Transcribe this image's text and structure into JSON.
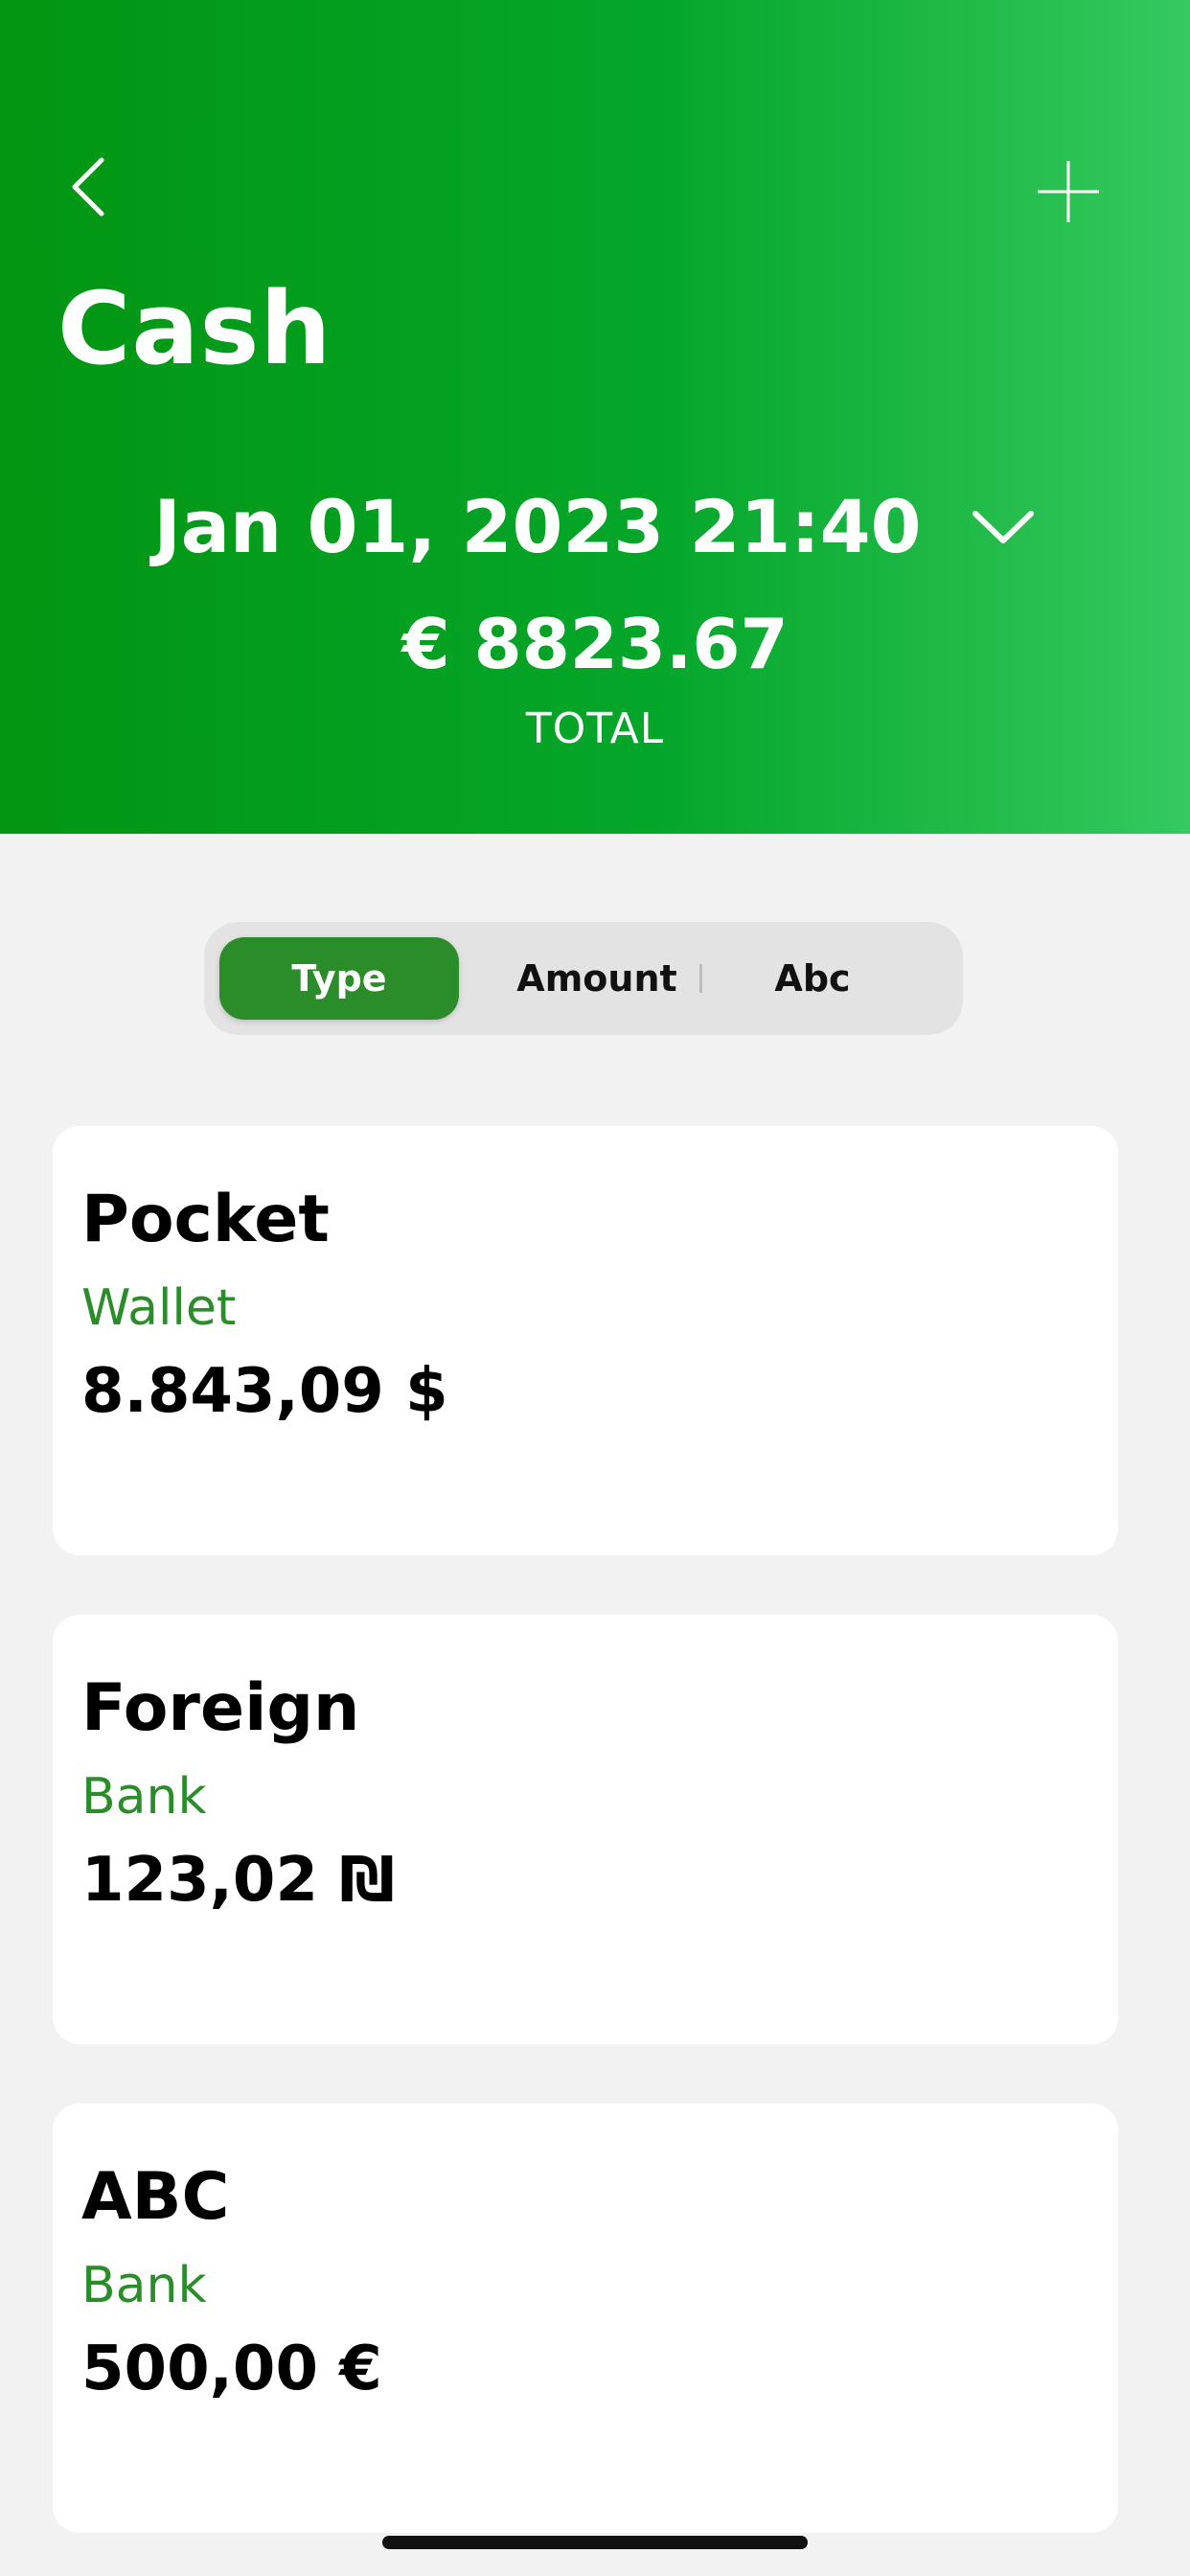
{
  "header": {
    "title": "Cash",
    "date": "Jan 01, 2023 21:40",
    "total_amount": "€ 8823.67",
    "total_label": "TOTAL",
    "colors": {
      "gradient_start": "#029512",
      "gradient_end": "#35c95f"
    }
  },
  "icons": {
    "back": "chevron-left-icon",
    "add": "plus-icon",
    "date_dropdown": "chevron-down-icon"
  },
  "segments": {
    "options": [
      "Type",
      "Amount",
      "Abc"
    ],
    "selected": "Type",
    "accent_color": "#2b8c2a"
  },
  "accounts": [
    {
      "name": "Pocket",
      "type": "Wallet",
      "balance": "8.843,09 $"
    },
    {
      "name": "Foreign",
      "type": "Bank",
      "balance": "123,02 ₪"
    },
    {
      "name": "ABC",
      "type": "Bank",
      "balance": "500,00 €"
    }
  ]
}
